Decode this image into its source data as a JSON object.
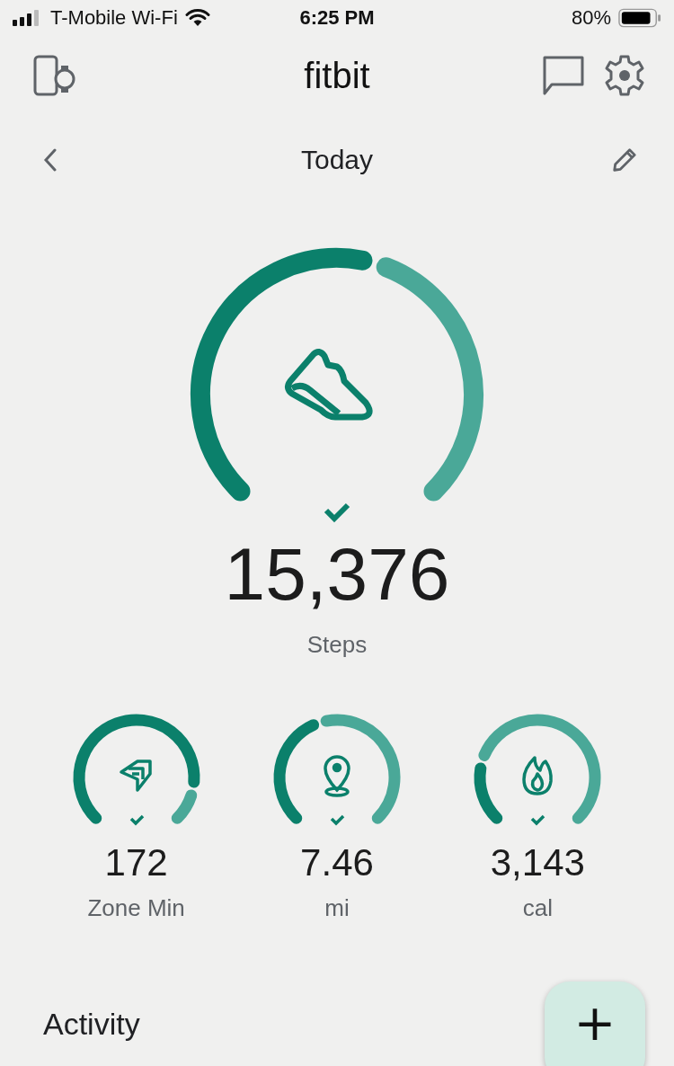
{
  "status_bar": {
    "carrier": "T-Mobile Wi-Fi",
    "time": "6:25 PM",
    "battery": "80%"
  },
  "header": {
    "title": "fitbit"
  },
  "date_nav": {
    "label": "Today"
  },
  "main_goal": {
    "kind": "steps",
    "value": "15,376",
    "label": "Steps",
    "achieved": true
  },
  "goals": [
    {
      "kind": "zone",
      "value": "172",
      "label": "Zone Min",
      "achieved": true
    },
    {
      "kind": "distance",
      "value": "7.46",
      "label": "mi",
      "achieved": true
    },
    {
      "kind": "calories",
      "value": "3,143",
      "label": "cal",
      "achieved": true
    }
  ],
  "section": {
    "title": "Activity"
  },
  "fab": {
    "label": "+"
  }
}
